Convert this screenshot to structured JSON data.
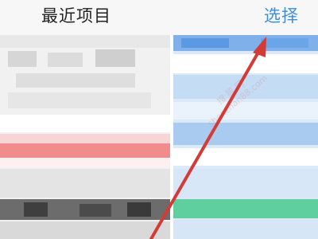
{
  "header": {
    "title": "最近项目",
    "select_label": "选择"
  },
  "watermark": {
    "line1": "搜 狐 网",
    "line2": "shenzhan88.com"
  },
  "colors": {
    "select_text": "#3d8edb",
    "arrow": "#d43a36",
    "highlight_red": "#f28b8b",
    "highlight_green": "#5fcf9f"
  }
}
